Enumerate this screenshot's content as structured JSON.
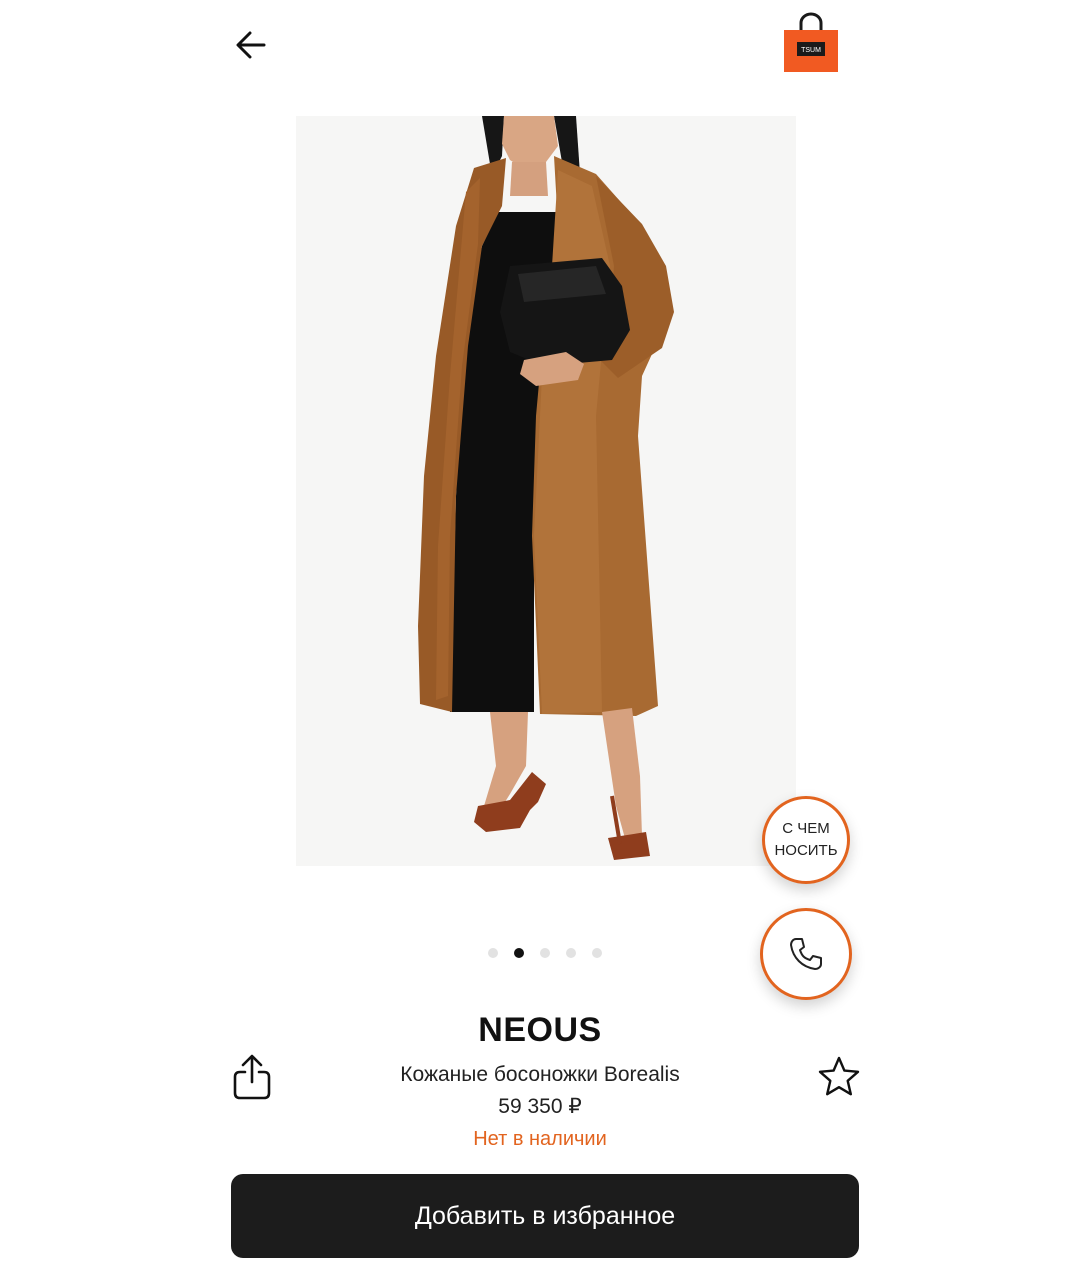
{
  "header": {
    "back_icon": "arrow-left-icon",
    "bag_icon": "shopping-bag-icon",
    "bag_logo_text": "TSUM",
    "accent_color": "#f15a22"
  },
  "gallery": {
    "image_description": "model wearing brown leather coat over black dress, holding black clutch, brown sandals",
    "total_slides": 5,
    "active_slide": 2
  },
  "fab": {
    "wear_line1": "С ЧЕМ",
    "wear_line2": "НОСИТЬ",
    "call_icon": "phone-icon",
    "accent_color": "#e2641f"
  },
  "product": {
    "brand": "NEOUS",
    "name": "Кожаные босоножки Borealis",
    "price": "59 350 ₽",
    "availability": "Нет в наличии",
    "availability_color": "#e2641f"
  },
  "actions": {
    "share_icon": "share-icon",
    "favorite_icon": "star-icon",
    "add_to_favorites_label": "Добавить в избранное"
  }
}
